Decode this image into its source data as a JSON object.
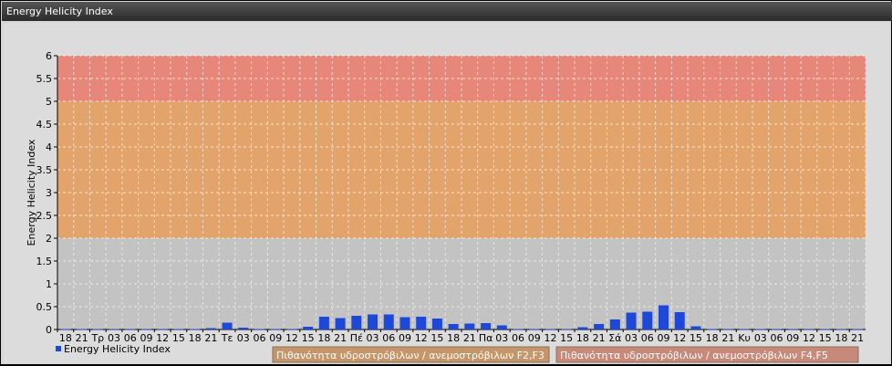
{
  "window": {
    "title": "Energy Helicity Index"
  },
  "chart_data": {
    "type": "bar",
    "title": "",
    "xlabel": "",
    "ylabel": "Energy Helicity Index",
    "ylim": [
      0,
      6
    ],
    "yticks": [
      "0",
      "0.5",
      "1",
      "1.5",
      "2",
      "2.5",
      "3",
      "3.5",
      "4",
      "4.5",
      "5",
      "5.5",
      "6"
    ],
    "grid": true,
    "bands": [
      {
        "from": 0,
        "to": 2,
        "color": "#c3c3c3"
      },
      {
        "from": 2,
        "to": 5,
        "color": "#e3a46c"
      },
      {
        "from": 5,
        "to": 6,
        "color": "#e6877a"
      }
    ],
    "bar_color": "#1e48d8",
    "categories": [
      "18",
      "21",
      "Τρ",
      "03",
      "06",
      "09",
      "12",
      "15",
      "18",
      "21",
      "Τε",
      "03",
      "06",
      "09",
      "12",
      "15",
      "18",
      "21",
      "Πέ",
      "03",
      "06",
      "09",
      "12",
      "15",
      "18",
      "21",
      "Πα",
      "03",
      "06",
      "09",
      "12",
      "15",
      "18",
      "21",
      "Σά",
      "03",
      "06",
      "09",
      "12",
      "15",
      "18",
      "21",
      "Κυ",
      "03",
      "06",
      "09",
      "12",
      "15",
      "18",
      "21"
    ],
    "series": [
      {
        "name": "Energy Helicity Index",
        "values": [
          0.01,
          0.01,
          0.01,
          0.01,
          0.01,
          0.01,
          0.01,
          0.01,
          0.01,
          0.03,
          0.15,
          0.04,
          0.01,
          0.01,
          0.01,
          0.06,
          0.28,
          0.25,
          0.3,
          0.33,
          0.33,
          0.27,
          0.28,
          0.24,
          0.12,
          0.13,
          0.14,
          0.09,
          0.01,
          0.01,
          0.01,
          0.01,
          0.05,
          0.12,
          0.22,
          0.37,
          0.39,
          0.53,
          0.38,
          0.07,
          0.01,
          0.01,
          0.01,
          0.01,
          0.01,
          0.01,
          0.01,
          0.01,
          0.01,
          0.01
        ]
      }
    ],
    "legend": "bottom-left",
    "band_legend": [
      {
        "label": "Πιθανότητα υδροστρόβιλων / ανεμοστρόβιλων F2,F3",
        "color": "#c49669"
      },
      {
        "label": "Πιθανότητα υδροστρόβιλων / ανεμοστρόβιλων F4,F5",
        "color": "#c78a7a"
      }
    ]
  }
}
